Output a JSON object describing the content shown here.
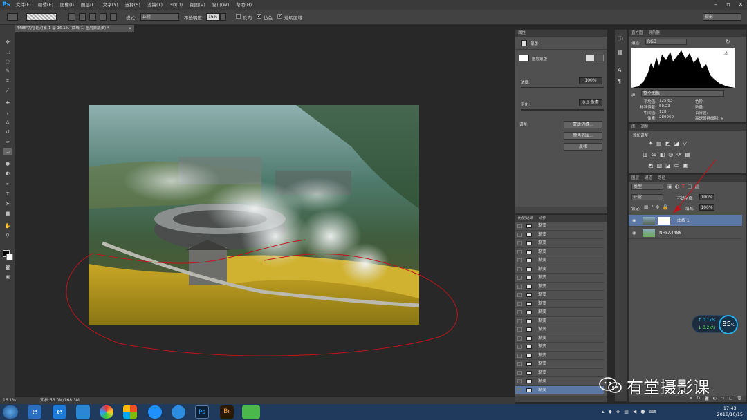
{
  "app": {
    "logo": "Ps"
  },
  "menu": [
    "文件(F)",
    "编辑(E)",
    "图像(I)",
    "图层(L)",
    "文字(Y)",
    "选择(S)",
    "滤镜(T)",
    "3D(D)",
    "视图(V)",
    "窗口(W)",
    "帮助(H)"
  ],
  "options_bar": {
    "mode_label": "模式:",
    "mode_value": "正常",
    "opacity_label": "不透明度:",
    "opacity_value": "16%",
    "reverse": "反向",
    "dither": "仿色",
    "transparency": "透明区域",
    "workspace": "摄影"
  },
  "document_tab": {
    "title": "4486\"为智能对象-1 @ 16.1% (曲线 1, 图层蒙版/8) *",
    "close": "×"
  },
  "properties_panel": {
    "tab": "属性",
    "mode_title": "蒙版",
    "layer_mask_label": "图层蒙版",
    "density_label": "浓度:",
    "density_value": "100%",
    "feather_label": "羽化:",
    "feather_value": "0.0 像素",
    "refine_label": "调整:",
    "mask_edge_button": "蒙版边缘...",
    "color_range_button": "颜色范围...",
    "invert_button": "反相"
  },
  "history_panel": {
    "tabs": [
      "历史记录",
      "动作"
    ],
    "items": [
      "渐变",
      "渐变",
      "渐变",
      "渐变",
      "渐变",
      "渐变",
      "渐变",
      "渐变",
      "渐变",
      "渐变",
      "渐变",
      "渐变",
      "渐变",
      "渐变",
      "渐变",
      "渐变",
      "渐变",
      "渐变",
      "渐变",
      "渐变"
    ]
  },
  "histogram_panel": {
    "tabs": [
      "直方图",
      "导航器"
    ],
    "channel_label": "通道:",
    "channel_value": "RGB",
    "source_label": "源:",
    "source_value": "整个图像",
    "stats": [
      {
        "label": "平均值:",
        "value": "125.63"
      },
      {
        "label": "标准偏差:",
        "value": "50.23"
      },
      {
        "label": "中间值:",
        "value": "128"
      },
      {
        "label": "像素:",
        "value": "289960"
      }
    ],
    "stats_right": [
      "色阶:",
      "数量:",
      "百分位:",
      "高速缓存级别: 4"
    ]
  },
  "adjustments_panel": {
    "tabs": [
      "库",
      "调整"
    ],
    "title": "添加调整"
  },
  "layers_panel": {
    "tabs": [
      "图层",
      "通道",
      "路径"
    ],
    "filter_value": "类型",
    "blend_value": "正常",
    "opacity_label": "不透明度:",
    "opacity_value": "100%",
    "lock_label": "锁定:",
    "fill_label": "填充:",
    "fill_value": "100%",
    "layers": [
      {
        "name": "曲线 1",
        "selected": true
      },
      {
        "name": "NHSA4486",
        "selected": false
      }
    ]
  },
  "status_bar": {
    "zoom": "16.1%",
    "doc": "文档:53.0M/168.3M"
  },
  "taskbar": {
    "time": "17:43",
    "date": "2018/10/15"
  },
  "speed_widget": {
    "up": "0.1k/s",
    "down": "0.2k/s",
    "percent": "85",
    "unit": "%"
  },
  "watermark": {
    "text": "有堂摄影课"
  },
  "colors": {
    "annotation_red": "#c0141c",
    "selection": "#5b78a5"
  }
}
